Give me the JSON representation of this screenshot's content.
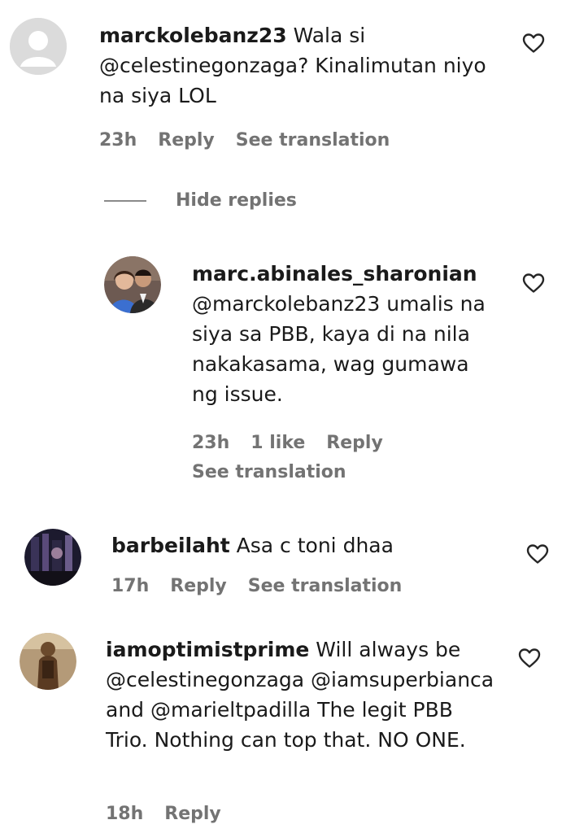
{
  "comments": [
    {
      "username": "marckolebanz23",
      "text": " Wala si @celestinegonzaga? Kinalimutan niyo na siya LOL",
      "time": "23h",
      "likes": "",
      "reply_label": "Reply",
      "translate_label": "See translation",
      "hide_replies_label": "Hide replies"
    },
    {
      "username": "marc.abinales_sharonian",
      "text": "@marckolebanz23 umalis na siya sa PBB, kaya di na nila nakakasama, wag gumawa ng issue.",
      "time": "23h",
      "likes": "1 like",
      "reply_label": "Reply",
      "translate_label": "See translation"
    },
    {
      "username": "barbeilaht",
      "text": " Asa c toni dhaa",
      "time": "17h",
      "likes": "",
      "reply_label": "Reply",
      "translate_label": "See translation"
    },
    {
      "username": "iamoptimistprime",
      "text": " Will always be @celestinegonzaga @iamsuperbianca and @marieltpadilla The legit PBB Trio. Nothing can top that. NO ONE.",
      "time": "18h",
      "likes": "",
      "reply_label": "Reply",
      "translate_label": ""
    }
  ],
  "icons": {
    "like": "heart-outline-icon",
    "default_avatar": "default-avatar-icon"
  },
  "colors": {
    "text": "#1a1a1a",
    "meta": "#737373",
    "default_avatar_bg": "#dbdbdb"
  }
}
